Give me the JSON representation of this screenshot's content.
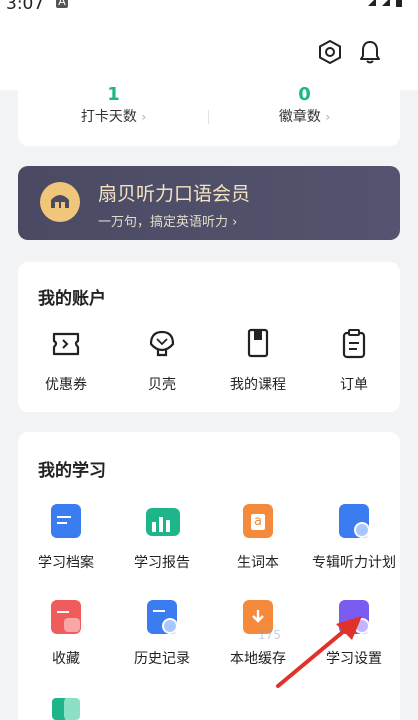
{
  "status": {
    "time": "3:07",
    "app_badge": "A"
  },
  "header": {
    "settings_icon": "hexagon-settings-icon",
    "notification_icon": "bell-icon"
  },
  "stats": [
    {
      "value": "1",
      "label": "打卡天数",
      "chev": "›"
    },
    {
      "value": "0",
      "label": "徽章数",
      "chev": "›"
    }
  ],
  "member": {
    "title": "扇贝听力口语会员",
    "subtitle": "一万句，搞定英语听力 ›"
  },
  "account": {
    "title": "我的账户",
    "items": [
      {
        "label": "优惠券",
        "icon": "coupon-icon"
      },
      {
        "label": "贝壳",
        "icon": "shell-icon"
      },
      {
        "label": "我的课程",
        "icon": "book-icon"
      },
      {
        "label": "订单",
        "icon": "order-clipboard-icon"
      }
    ]
  },
  "study": {
    "title": "我的学习",
    "items": [
      {
        "label": "学习档案",
        "icon": "archive-icon"
      },
      {
        "label": "学习报告",
        "icon": "report-chart-icon"
      },
      {
        "label": "生词本",
        "icon": "vocabulary-book-icon"
      },
      {
        "label": "专辑听力计划",
        "icon": "listening-plan-icon"
      },
      {
        "label": "收藏",
        "icon": "favorites-icon"
      },
      {
        "label": "历史记录",
        "icon": "history-icon"
      },
      {
        "label": "本地缓存",
        "icon": "local-cache-icon"
      },
      {
        "label": "学习设置",
        "icon": "study-settings-icon"
      }
    ]
  },
  "colors": {
    "accent_green": "#1fb58b",
    "member_bg": "#4a4a63",
    "member_gold": "#f6e4bf",
    "arrow_red": "#e0322b"
  },
  "watermark": "175"
}
